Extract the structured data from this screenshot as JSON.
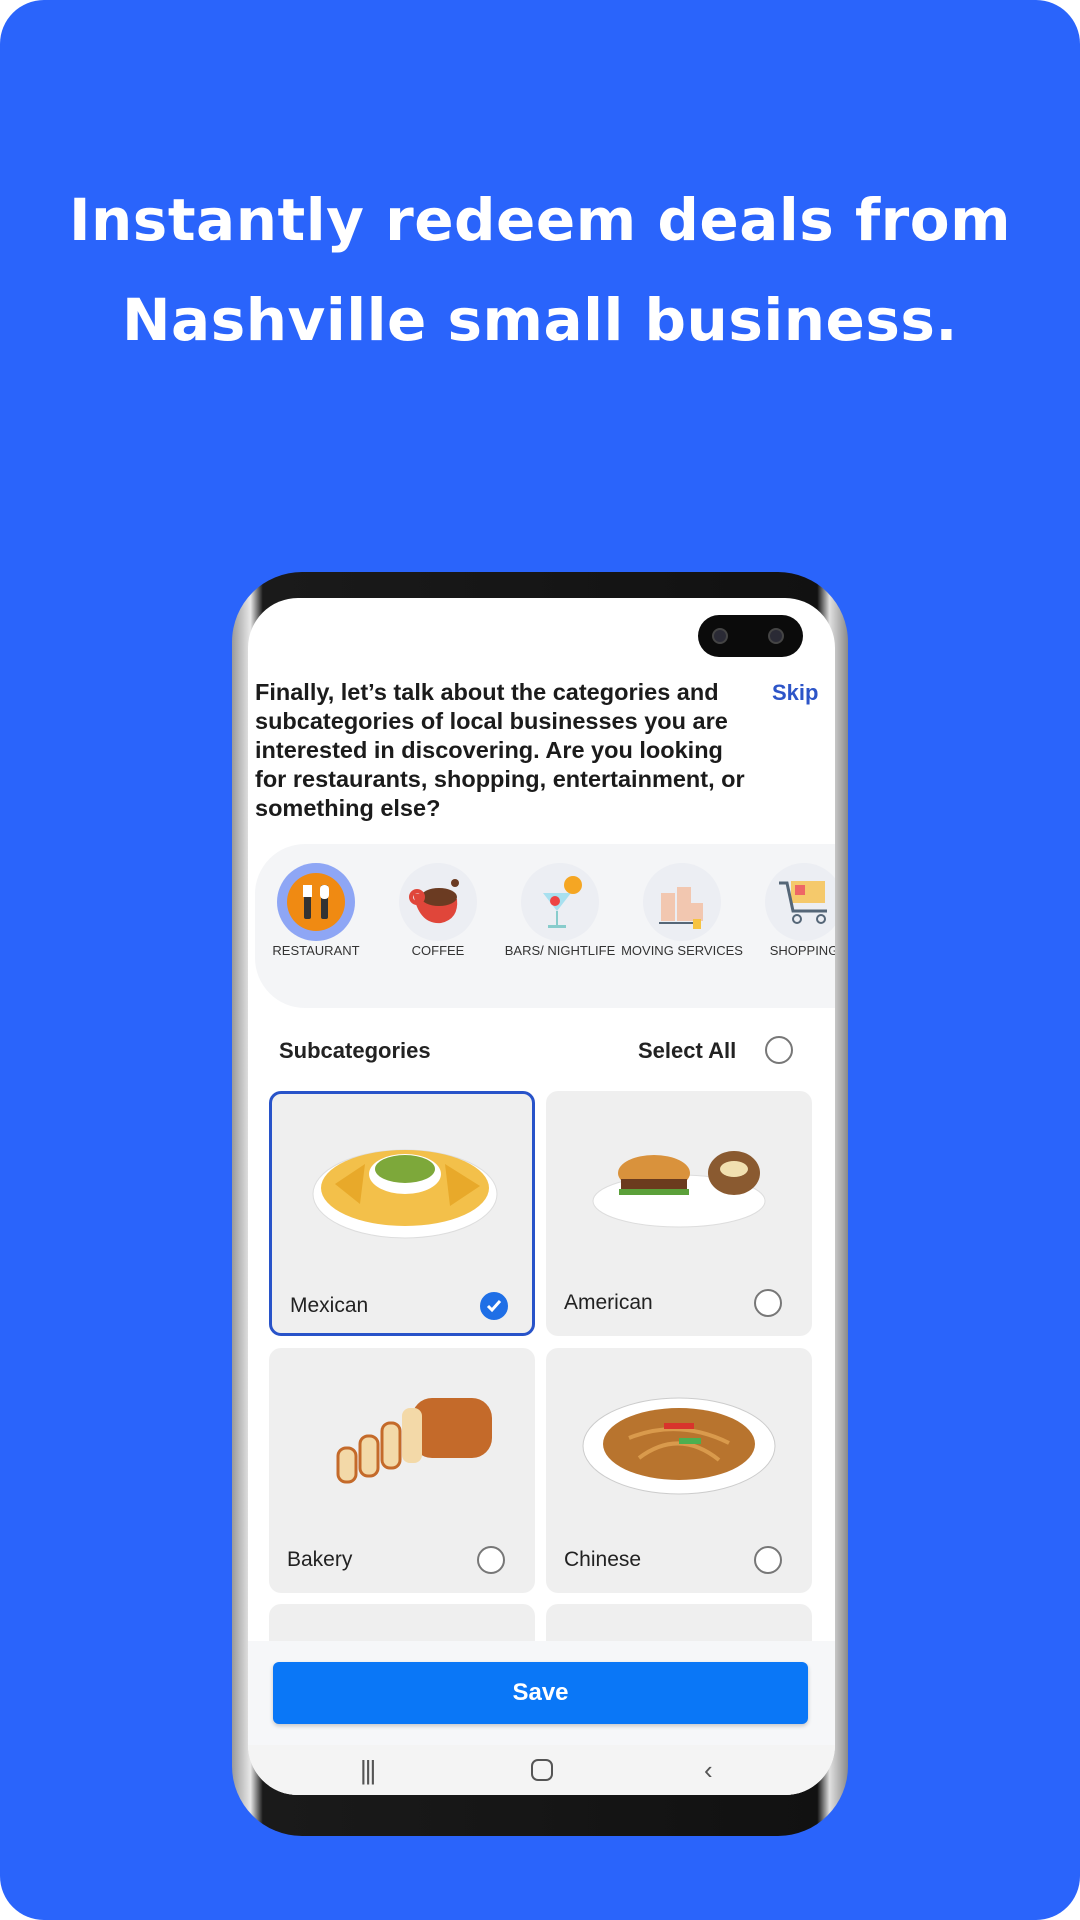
{
  "headline": {
    "line1": "Instantly redeem deals from",
    "line2": "Nashville small business."
  },
  "app": {
    "question": "Finally, let’s talk about the categories and subcategories of local businesses you are interested in discovering. Are you looking for restaurants, shopping, entertainment, or something else?",
    "skip_label": "Skip",
    "categories": [
      {
        "label": "RESTAURANT",
        "icon": "restaurant-icon",
        "selected": true
      },
      {
        "label": "COFFEE",
        "icon": "coffee-icon",
        "selected": false
      },
      {
        "label": "BARS/ NIGHTLIFE",
        "icon": "cocktail-icon",
        "selected": false
      },
      {
        "label": "MOVING SERVICES",
        "icon": "moving-icon",
        "selected": false
      },
      {
        "label": "SHOPPING",
        "icon": "shopping-cart-icon",
        "selected": false
      }
    ],
    "subcategories_title": "Subcategories",
    "select_all_label": "Select All",
    "subcategories": [
      {
        "name": "Mexican",
        "selected": true
      },
      {
        "name": "American",
        "selected": false
      },
      {
        "name": "Bakery",
        "selected": false
      },
      {
        "name": "Chinese",
        "selected": false
      }
    ],
    "save_label": "Save",
    "accent_color": "#0a77f7",
    "background_color": "#2a64fb"
  }
}
